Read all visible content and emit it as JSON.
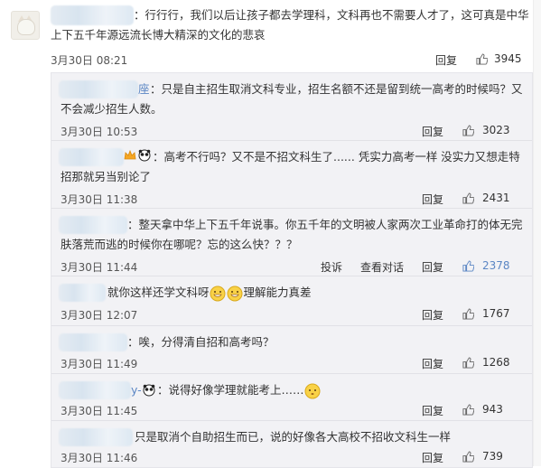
{
  "main_comment": {
    "text_line1": "：行行行，我们以后让孩子都去学理科，文科再也不需要人才了，这可真是中华",
    "text_line2": "上下五千年源远流长博大精深的文化的悲哀",
    "time": "3月30日 08:21",
    "reply_label": "回复",
    "likes": "3945"
  },
  "replies": [
    {
      "name_tail": "座",
      "text_line1": "：只是自主招生取消文科专业，招生名额不还是留到统一高考的时候吗？又",
      "text_line2": "不会减少招生人数。",
      "time": "3月30日 10:53",
      "reply_label": "回复",
      "likes": "3023"
    },
    {
      "text_line1": "：高考不行吗？又不是不招文科生了...... 凭实力高考一样 没实力又想走特",
      "text_line2": "招那就另当别论了",
      "time": "3月30日 11:38",
      "reply_label": "回复",
      "likes": "2431"
    },
    {
      "text_line1": "：整天拿中华上下五千年说事。你五千年的文明被人家两次工业革命打的体无完",
      "text_line2": "肤落荒而逃的时候你在哪呢？忘的这么快？？？",
      "time": "3月30日 11:44",
      "report_label": "投诉",
      "dialog_label": "查看对话",
      "reply_label": "回复",
      "likes": "2378"
    },
    {
      "text_before": "就你这样还学文科呀",
      "text_after": "理解能力真差",
      "time": "3月30日 12:07",
      "reply_label": "回复",
      "likes": "1767"
    },
    {
      "text": "：唉，分得清自招和高考吗？",
      "time": "3月30日 11:49",
      "reply_label": "回复",
      "likes": "1268"
    },
    {
      "name_tail": "y-",
      "text": "：说得好像学理就能考上……",
      "time": "3月30日 11:45",
      "reply_label": "回复",
      "likes": "943"
    },
    {
      "text": "只是取消个自助招生而已，说的好像各大高校不招收文科生一样",
      "time": "3月30日 11:46",
      "reply_label": "回复",
      "likes": "739"
    }
  ],
  "colors": {
    "accent_blue": "#5b86c4",
    "panel_bg": "#f2f2f5",
    "text": "#333333",
    "meta": "#555555"
  }
}
